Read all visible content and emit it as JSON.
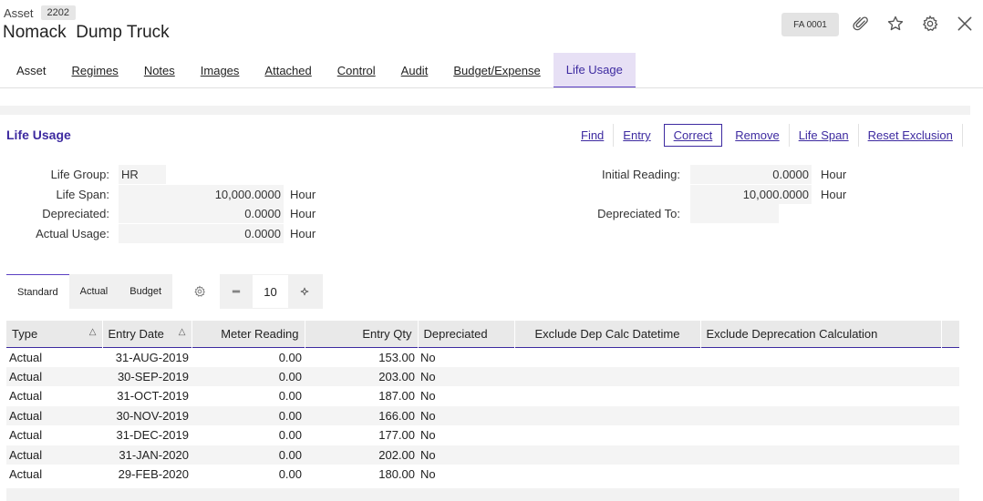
{
  "header": {
    "crumb_label": "Asset",
    "crumb_id": "2202",
    "title": "Nomack  Dump Truck",
    "fa_badge": "FA 0001"
  },
  "tabs": [
    {
      "label": "Asset"
    },
    {
      "label": "Regimes"
    },
    {
      "label": "Notes"
    },
    {
      "label": "Images"
    },
    {
      "label": "Attached"
    },
    {
      "label": "Control"
    },
    {
      "label": "Audit"
    },
    {
      "label": "Budget/Expense"
    },
    {
      "label": "Life Usage"
    }
  ],
  "section": {
    "title": "Life Usage",
    "actions": [
      "Find",
      "Entry",
      "Correct",
      "Remove",
      "Life Span",
      "Reset Exclusion"
    ]
  },
  "fields": {
    "life_group": {
      "label": "Life Group:",
      "value": "HR"
    },
    "life_span": {
      "label": "Life Span:",
      "value": "10,000.0000",
      "unit": "Hour"
    },
    "depreciated": {
      "label": "Depreciated:",
      "value": "0.0000",
      "unit": "Hour"
    },
    "actual_usage": {
      "label": "Actual Usage:",
      "value": "0.0000",
      "unit": "Hour"
    },
    "initial_reading": {
      "label": "Initial Reading:",
      "value": "0.0000",
      "unit": "Hour"
    },
    "life_span_right": {
      "value": "10,000.0000",
      "unit": "Hour"
    },
    "depreciated_to": {
      "label": "Depreciated To:",
      "value": ""
    }
  },
  "subtabs": [
    "Standard",
    "Actual",
    "Budget"
  ],
  "pager": {
    "page_size": "10"
  },
  "grid": {
    "columns": [
      "Type",
      "Entry Date",
      "Meter Reading",
      "Entry Qty",
      "Depreciated",
      "Exclude Dep Calc Datetime",
      "Exclude Deprecation Calculation"
    ],
    "rows": [
      [
        "Actual",
        "31-AUG-2019",
        "0.00",
        "153.00",
        "No",
        "",
        ""
      ],
      [
        "Actual",
        "30-SEP-2019",
        "0.00",
        "203.00",
        "No",
        "",
        ""
      ],
      [
        "Actual",
        "31-OCT-2019",
        "0.00",
        "187.00",
        "No",
        "",
        ""
      ],
      [
        "Actual",
        "30-NOV-2019",
        "0.00",
        "166.00",
        "No",
        "",
        ""
      ],
      [
        "Actual",
        "31-DEC-2019",
        "0.00",
        "177.00",
        "No",
        "",
        ""
      ],
      [
        "Actual",
        "31-JAN-2020",
        "0.00",
        "202.00",
        "No",
        "",
        ""
      ],
      [
        "Actual",
        "29-FEB-2020",
        "0.00",
        "180.00",
        "No",
        "",
        ""
      ]
    ]
  },
  "colors": {
    "accent": "#3d2aa0",
    "active_tab_bg": "#e7e0f5"
  },
  "icons": [
    "paperclip-icon",
    "star-icon",
    "gear-icon",
    "close-icon",
    "sort-asc-icon",
    "minus-icon",
    "plus-icon"
  ]
}
